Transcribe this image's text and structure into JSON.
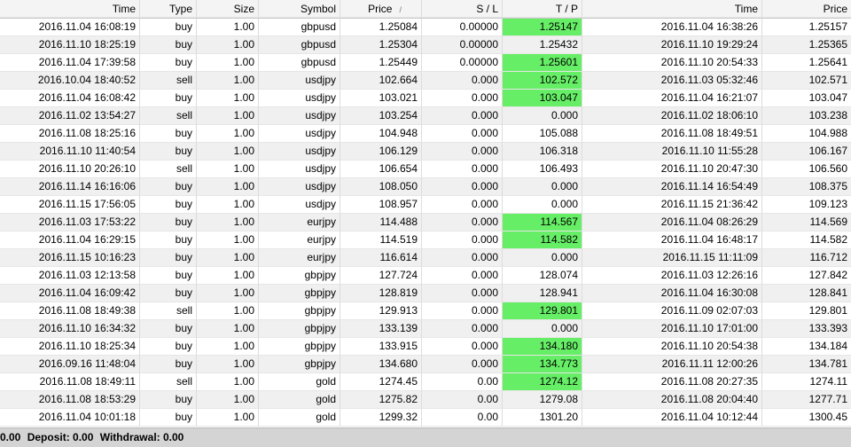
{
  "columns": [
    "Time",
    "Type",
    "Size",
    "Symbol",
    "Price",
    "S / L",
    "T / P",
    "Time",
    "Price"
  ],
  "sort_indicator": "/",
  "rows": [
    {
      "time": "2016.11.04 16:08:19",
      "type": "buy",
      "size": "1.00",
      "symbol": "gbpusd",
      "price": "1.25084",
      "sl": "0.00000",
      "tp": "1.25147",
      "tp_hit": true,
      "close_time": "2016.11.04 16:38:26",
      "close_price": "1.25157"
    },
    {
      "time": "2016.11.10 18:25:19",
      "type": "buy",
      "size": "1.00",
      "symbol": "gbpusd",
      "price": "1.25304",
      "sl": "0.00000",
      "tp": "1.25432",
      "tp_hit": false,
      "close_time": "2016.11.10 19:29:24",
      "close_price": "1.25365"
    },
    {
      "time": "2016.11.04 17:39:58",
      "type": "buy",
      "size": "1.00",
      "symbol": "gbpusd",
      "price": "1.25449",
      "sl": "0.00000",
      "tp": "1.25601",
      "tp_hit": true,
      "close_time": "2016.11.10 20:54:33",
      "close_price": "1.25641"
    },
    {
      "time": "2016.10.04 18:40:52",
      "type": "sell",
      "size": "1.00",
      "symbol": "usdjpy",
      "price": "102.664",
      "sl": "0.000",
      "tp": "102.572",
      "tp_hit": true,
      "close_time": "2016.11.03 05:32:46",
      "close_price": "102.571"
    },
    {
      "time": "2016.11.04 16:08:42",
      "type": "buy",
      "size": "1.00",
      "symbol": "usdjpy",
      "price": "103.021",
      "sl": "0.000",
      "tp": "103.047",
      "tp_hit": true,
      "close_time": "2016.11.04 16:21:07",
      "close_price": "103.047"
    },
    {
      "time": "2016.11.02 13:54:27",
      "type": "sell",
      "size": "1.00",
      "symbol": "usdjpy",
      "price": "103.254",
      "sl": "0.000",
      "tp": "0.000",
      "tp_hit": false,
      "close_time": "2016.11.02 18:06:10",
      "close_price": "103.238"
    },
    {
      "time": "2016.11.08 18:25:16",
      "type": "buy",
      "size": "1.00",
      "symbol": "usdjpy",
      "price": "104.948",
      "sl": "0.000",
      "tp": "105.088",
      "tp_hit": false,
      "close_time": "2016.11.08 18:49:51",
      "close_price": "104.988"
    },
    {
      "time": "2016.11.10 11:40:54",
      "type": "buy",
      "size": "1.00",
      "symbol": "usdjpy",
      "price": "106.129",
      "sl": "0.000",
      "tp": "106.318",
      "tp_hit": false,
      "close_time": "2016.11.10 11:55:28",
      "close_price": "106.167"
    },
    {
      "time": "2016.11.10 20:26:10",
      "type": "sell",
      "size": "1.00",
      "symbol": "usdjpy",
      "price": "106.654",
      "sl": "0.000",
      "tp": "106.493",
      "tp_hit": false,
      "close_time": "2016.11.10 20:47:30",
      "close_price": "106.560"
    },
    {
      "time": "2016.11.14 16:16:06",
      "type": "buy",
      "size": "1.00",
      "symbol": "usdjpy",
      "price": "108.050",
      "sl": "0.000",
      "tp": "0.000",
      "tp_hit": false,
      "close_time": "2016.11.14 16:54:49",
      "close_price": "108.375"
    },
    {
      "time": "2016.11.15 17:56:05",
      "type": "buy",
      "size": "1.00",
      "symbol": "usdjpy",
      "price": "108.957",
      "sl": "0.000",
      "tp": "0.000",
      "tp_hit": false,
      "close_time": "2016.11.15 21:36:42",
      "close_price": "109.123"
    },
    {
      "time": "2016.11.03 17:53:22",
      "type": "buy",
      "size": "1.00",
      "symbol": "eurjpy",
      "price": "114.488",
      "sl": "0.000",
      "tp": "114.567",
      "tp_hit": true,
      "close_time": "2016.11.04 08:26:29",
      "close_price": "114.569"
    },
    {
      "time": "2016.11.04 16:29:15",
      "type": "buy",
      "size": "1.00",
      "symbol": "eurjpy",
      "price": "114.519",
      "sl": "0.000",
      "tp": "114.582",
      "tp_hit": true,
      "close_time": "2016.11.04 16:48:17",
      "close_price": "114.582"
    },
    {
      "time": "2016.11.15 10:16:23",
      "type": "buy",
      "size": "1.00",
      "symbol": "eurjpy",
      "price": "116.614",
      "sl": "0.000",
      "tp": "0.000",
      "tp_hit": false,
      "close_time": "2016.11.15 11:11:09",
      "close_price": "116.712"
    },
    {
      "time": "2016.11.03 12:13:58",
      "type": "buy",
      "size": "1.00",
      "symbol": "gbpjpy",
      "price": "127.724",
      "sl": "0.000",
      "tp": "128.074",
      "tp_hit": false,
      "close_time": "2016.11.03 12:26:16",
      "close_price": "127.842"
    },
    {
      "time": "2016.11.04 16:09:42",
      "type": "buy",
      "size": "1.00",
      "symbol": "gbpjpy",
      "price": "128.819",
      "sl": "0.000",
      "tp": "128.941",
      "tp_hit": false,
      "close_time": "2016.11.04 16:30:08",
      "close_price": "128.841"
    },
    {
      "time": "2016.11.08 18:49:38",
      "type": "sell",
      "size": "1.00",
      "symbol": "gbpjpy",
      "price": "129.913",
      "sl": "0.000",
      "tp": "129.801",
      "tp_hit": true,
      "close_time": "2016.11.09 02:07:03",
      "close_price": "129.801"
    },
    {
      "time": "2016.11.10 16:34:32",
      "type": "buy",
      "size": "1.00",
      "symbol": "gbpjpy",
      "price": "133.139",
      "sl": "0.000",
      "tp": "0.000",
      "tp_hit": false,
      "close_time": "2016.11.10 17:01:00",
      "close_price": "133.393"
    },
    {
      "time": "2016.11.10 18:25:34",
      "type": "buy",
      "size": "1.00",
      "symbol": "gbpjpy",
      "price": "133.915",
      "sl": "0.000",
      "tp": "134.180",
      "tp_hit": true,
      "close_time": "2016.11.10 20:54:38",
      "close_price": "134.184"
    },
    {
      "time": "2016.09.16 11:48:04",
      "type": "buy",
      "size": "1.00",
      "symbol": "gbpjpy",
      "price": "134.680",
      "sl": "0.000",
      "tp": "134.773",
      "tp_hit": true,
      "close_time": "2016.11.11 12:00:26",
      "close_price": "134.781"
    },
    {
      "time": "2016.11.08 18:49:11",
      "type": "sell",
      "size": "1.00",
      "symbol": "gold",
      "price": "1274.45",
      "sl": "0.00",
      "tp": "1274.12",
      "tp_hit": true,
      "close_time": "2016.11.08 20:27:35",
      "close_price": "1274.11"
    },
    {
      "time": "2016.11.08 18:53:29",
      "type": "buy",
      "size": "1.00",
      "symbol": "gold",
      "price": "1275.82",
      "sl": "0.00",
      "tp": "1279.08",
      "tp_hit": false,
      "close_time": "2016.11.08 20:04:40",
      "close_price": "1277.71"
    },
    {
      "time": "2016.11.04 10:01:18",
      "type": "buy",
      "size": "1.00",
      "symbol": "gold",
      "price": "1299.32",
      "sl": "0.00",
      "tp": "1301.20",
      "tp_hit": false,
      "close_time": "2016.11.04 10:12:44",
      "close_price": "1300.45"
    }
  ],
  "status": {
    "lead": "0.00",
    "deposit": "Deposit: 0.00",
    "withdrawal": "Withdrawal: 0.00"
  },
  "colors": {
    "tp_highlight": "#66ee66",
    "row_alt": "#f0f0f0",
    "status_bar": "#d4d4d4"
  }
}
